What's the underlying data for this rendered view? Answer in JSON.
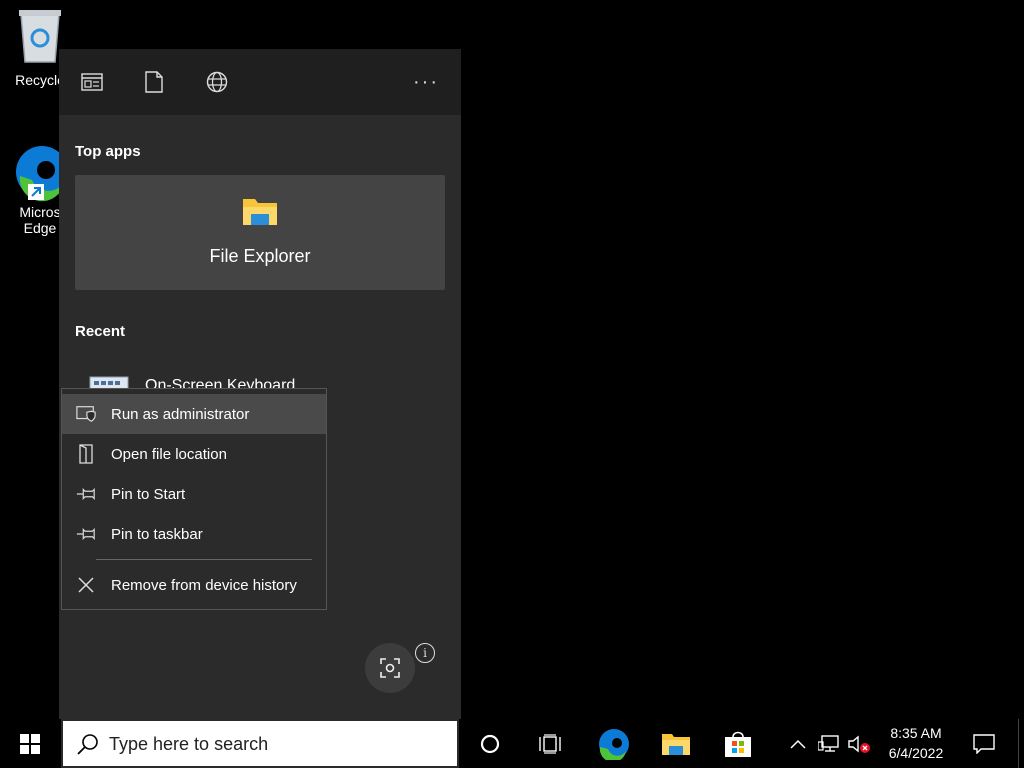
{
  "desktop": {
    "recycle_bin_label": "Recycle",
    "edge_label_line1": "Micros",
    "edge_label_line2": "Edge"
  },
  "panel": {
    "filters": [
      {
        "name": "apps",
        "icon": "apps-window-icon"
      },
      {
        "name": "documents",
        "icon": "document-icon"
      },
      {
        "name": "web",
        "icon": "globe-icon"
      }
    ],
    "more_label": "···",
    "top_apps_title": "Top apps",
    "top_app": {
      "label": "File Explorer",
      "icon": "folder-icon"
    },
    "recent_title": "Recent",
    "recent_item_label": "On-Screen Keyboard",
    "info_label": "i"
  },
  "context_menu": {
    "items": [
      {
        "label": "Run as administrator",
        "icon": "shield-icon"
      },
      {
        "label": "Open file location",
        "icon": "file-location-icon"
      },
      {
        "label": "Pin to Start",
        "icon": "pin-icon"
      },
      {
        "label": "Pin to taskbar",
        "icon": "pin-icon"
      },
      {
        "label": "Remove from device history",
        "icon": "close-icon"
      }
    ]
  },
  "taskbar": {
    "search_placeholder": "Type here to search",
    "time": "8:35 AM",
    "date": "6/4/2022"
  },
  "colors": {
    "panel_bg": "#2b2b2b",
    "tile_bg": "#444444",
    "menu_hover": "#4a4a4a",
    "edge_blue": "#0c7bd6",
    "edge_green": "#4ec33a",
    "folder_yellow": "#f8c53a"
  }
}
